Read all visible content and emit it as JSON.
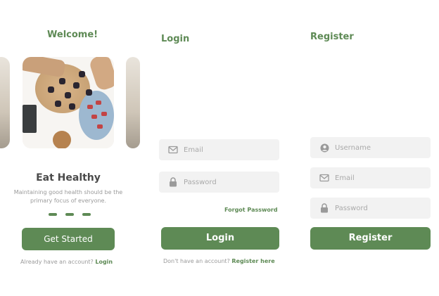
{
  "welcome": {
    "title": "Welcome!",
    "headline": "Eat Healthy",
    "subtitle": "Maintaining good health should be the primary focus of everyone.",
    "carousel_dots": 3,
    "cta_label": "Get Started",
    "footer_text": "Already have an account?",
    "footer_link": "Login"
  },
  "login": {
    "title": "Login",
    "email_placeholder": "Email",
    "password_placeholder": "Password",
    "forgot_label": "Forgot Password",
    "submit_label": "Login",
    "footer_text": "Don't have an account?",
    "footer_link": "Register here"
  },
  "register": {
    "title": "Register",
    "username_placeholder": "Username",
    "email_placeholder": "Email",
    "password_placeholder": "Password",
    "submit_label": "Register"
  },
  "colors": {
    "accent": "#5e8a55",
    "field_bg": "#f2f2f2",
    "muted_text": "#9a9a9a"
  },
  "icons": [
    "mail-icon",
    "lock-icon",
    "user-icon"
  ]
}
